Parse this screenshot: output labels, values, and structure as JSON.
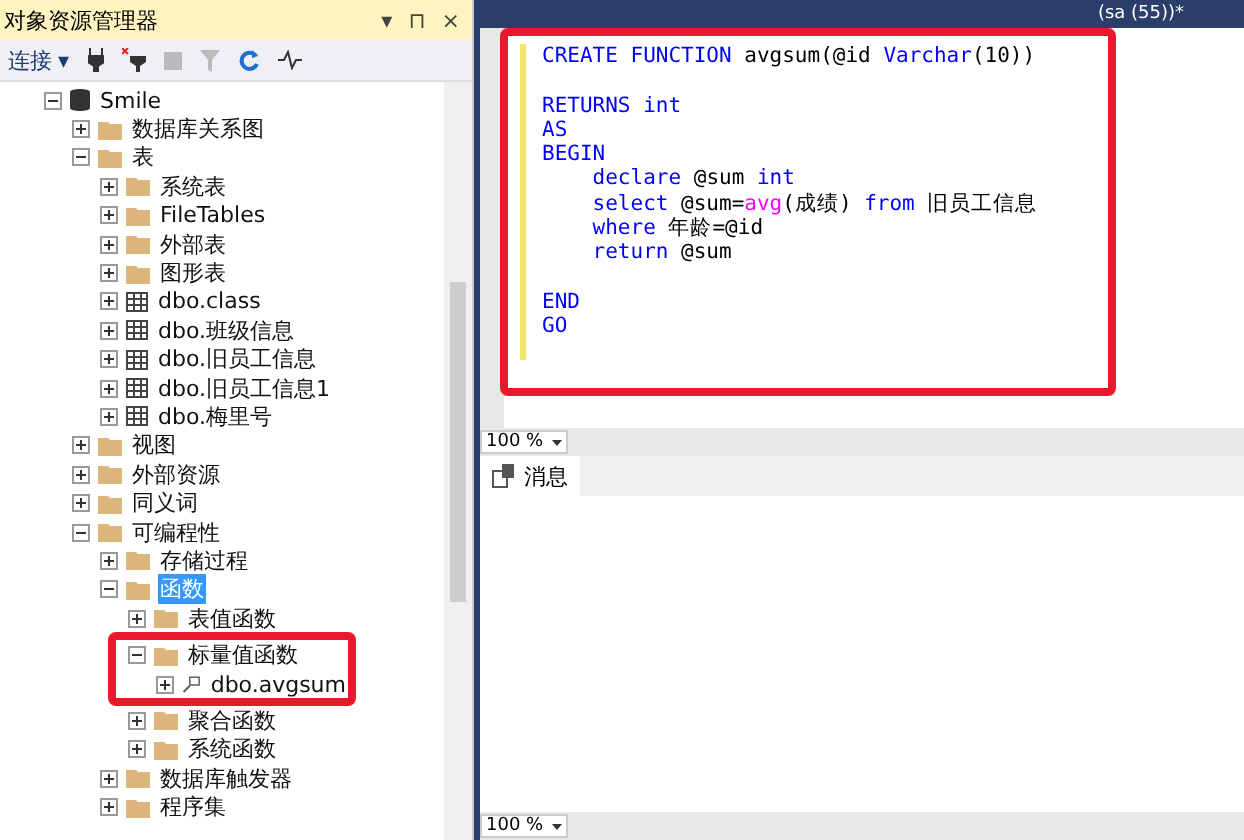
{
  "explorer": {
    "title": "对象资源管理器",
    "header_controls": [
      "▾",
      "⊓",
      "×"
    ],
    "toolbar": {
      "connect_label": "连接",
      "connect_caret": "▾"
    },
    "tree": [
      {
        "label": "Smile",
        "kind": "database",
        "expanded": true,
        "selected": false,
        "highlighted": false,
        "children": [
          {
            "label": "数据库关系图",
            "kind": "folder",
            "expanded": false,
            "selected": false,
            "highlighted": false
          },
          {
            "label": "表",
            "kind": "folder",
            "expanded": true,
            "selected": false,
            "highlighted": false,
            "children": [
              {
                "label": "系统表",
                "kind": "folder",
                "expanded": false,
                "selected": false,
                "highlighted": false
              },
              {
                "label": "FileTables",
                "kind": "folder",
                "expanded": false,
                "selected": false,
                "highlighted": false
              },
              {
                "label": "外部表",
                "kind": "folder",
                "expanded": false,
                "selected": false,
                "highlighted": false
              },
              {
                "label": "图形表",
                "kind": "folder",
                "expanded": false,
                "selected": false,
                "highlighted": false
              },
              {
                "label": "dbo.class",
                "kind": "table",
                "expanded": false,
                "selected": false,
                "highlighted": false
              },
              {
                "label": "dbo.班级信息",
                "kind": "table",
                "expanded": false,
                "selected": false,
                "highlighted": false
              },
              {
                "label": "dbo.旧员工信息",
                "kind": "table",
                "expanded": false,
                "selected": false,
                "highlighted": false
              },
              {
                "label": "dbo.旧员工信息1",
                "kind": "table",
                "expanded": false,
                "selected": false,
                "highlighted": false
              },
              {
                "label": "dbo.梅里号",
                "kind": "table",
                "expanded": false,
                "selected": false,
                "highlighted": false
              }
            ]
          },
          {
            "label": "视图",
            "kind": "folder",
            "expanded": false,
            "selected": false,
            "highlighted": false
          },
          {
            "label": "外部资源",
            "kind": "folder",
            "expanded": false,
            "selected": false,
            "highlighted": false
          },
          {
            "label": "同义词",
            "kind": "folder",
            "expanded": false,
            "selected": false,
            "highlighted": false
          },
          {
            "label": "可编程性",
            "kind": "folder",
            "expanded": true,
            "selected": false,
            "highlighted": false,
            "children": [
              {
                "label": "存储过程",
                "kind": "folder",
                "expanded": false,
                "selected": false,
                "highlighted": false
              },
              {
                "label": "函数",
                "kind": "folder",
                "expanded": true,
                "selected": true,
                "highlighted": false,
                "children": [
                  {
                    "label": "表值函数",
                    "kind": "folder",
                    "expanded": false,
                    "selected": false,
                    "highlighted": false
                  },
                  {
                    "label": "标量值函数",
                    "kind": "folder",
                    "expanded": true,
                    "selected": false,
                    "highlighted": true,
                    "children": [
                      {
                        "label": "dbo.avgsum",
                        "kind": "function",
                        "expanded": false,
                        "selected": false,
                        "highlighted": false
                      }
                    ]
                  },
                  {
                    "label": "聚合函数",
                    "kind": "folder",
                    "expanded": false,
                    "selected": false,
                    "highlighted": false
                  },
                  {
                    "label": "系统函数",
                    "kind": "folder",
                    "expanded": false,
                    "selected": false,
                    "highlighted": false
                  }
                ]
              },
              {
                "label": "数据库触发器",
                "kind": "folder",
                "expanded": false,
                "selected": false,
                "highlighted": false
              },
              {
                "label": "程序集",
                "kind": "folder",
                "expanded": false,
                "selected": false,
                "highlighted": false
              }
            ]
          }
        ]
      }
    ]
  },
  "editor": {
    "tab_label": "(sa (55))*",
    "highlighted": true,
    "lines": [
      [
        {
          "t": "CREATE FUNCTION",
          "kind": "keyword"
        },
        {
          "t": " avgsum(@id ",
          "kind": "text"
        },
        {
          "t": "Varchar",
          "kind": "keyword"
        },
        {
          "t": "(10))",
          "kind": "text"
        }
      ],
      [
        {
          "t": "RETURNS int",
          "kind": "keyword",
          "gap_before": true
        }
      ],
      [
        {
          "t": "AS",
          "kind": "keyword"
        }
      ],
      [
        {
          "t": "BEGIN",
          "kind": "keyword"
        }
      ],
      [
        {
          "t": "    declare",
          "kind": "keyword"
        },
        {
          "t": " @sum ",
          "kind": "text"
        },
        {
          "t": "int",
          "kind": "keyword"
        }
      ],
      [
        {
          "t": "    select",
          "kind": "keyword"
        },
        {
          "t": " @sum=",
          "kind": "text"
        },
        {
          "t": "avg",
          "kind": "function"
        },
        {
          "t": "(成绩) ",
          "kind": "text"
        },
        {
          "t": "from",
          "kind": "keyword"
        },
        {
          "t": " 旧员工信息",
          "kind": "text"
        }
      ],
      [
        {
          "t": "    where",
          "kind": "keyword"
        },
        {
          "t": " 年龄=@id",
          "kind": "text"
        }
      ],
      [
        {
          "t": "    return",
          "kind": "keyword"
        },
        {
          "t": " @sum",
          "kind": "text"
        }
      ],
      [
        {
          "t": "END",
          "kind": "keyword",
          "gap_before": true
        }
      ],
      [
        {
          "t": "GO",
          "kind": "keyword"
        }
      ]
    ],
    "zoom": "100 %"
  },
  "results": {
    "tab_label": "消息",
    "zoom": "100 %"
  }
}
